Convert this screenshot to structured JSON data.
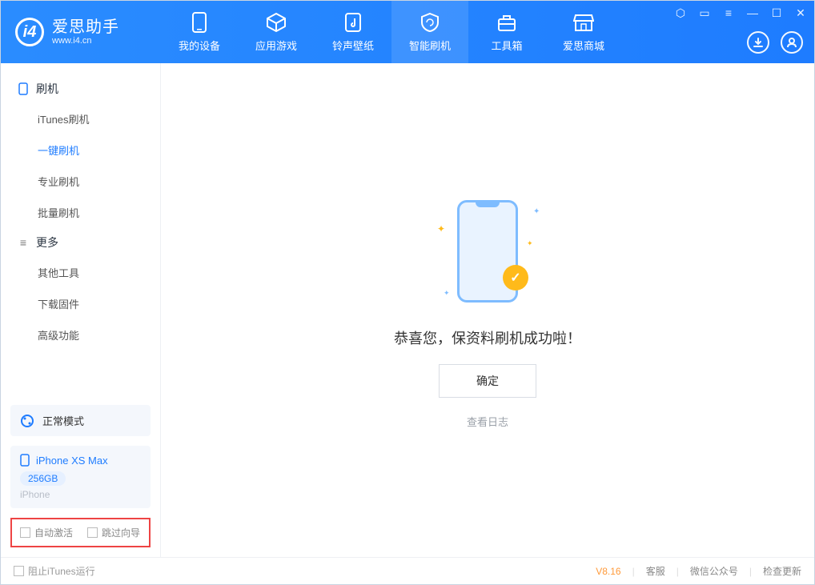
{
  "app": {
    "title": "爱思助手",
    "subtitle": "www.i4.cn"
  },
  "tabs": [
    {
      "id": "device",
      "label": "我的设备"
    },
    {
      "id": "apps",
      "label": "应用游戏"
    },
    {
      "id": "ring",
      "label": "铃声壁纸"
    },
    {
      "id": "flash",
      "label": "智能刷机"
    },
    {
      "id": "tools",
      "label": "工具箱"
    },
    {
      "id": "store",
      "label": "爱思商城"
    }
  ],
  "sidebar": {
    "group1_title": "刷机",
    "items1": [
      {
        "label": "iTunes刷机"
      },
      {
        "label": "一键刷机"
      },
      {
        "label": "专业刷机"
      },
      {
        "label": "批量刷机"
      }
    ],
    "group2_title": "更多",
    "items2": [
      {
        "label": "其他工具"
      },
      {
        "label": "下载固件"
      },
      {
        "label": "高级功能"
      }
    ],
    "mode_label": "正常模式",
    "device": {
      "name": "iPhone XS Max",
      "storage": "256GB",
      "type": "iPhone"
    },
    "chk_auto_activate": "自动激活",
    "chk_skip_guide": "跳过向导"
  },
  "main": {
    "success_message": "恭喜您，保资料刷机成功啦！",
    "ok_button": "确定",
    "view_log": "查看日志"
  },
  "footer": {
    "block_itunes": "阻止iTunes运行",
    "version": "V8.16",
    "support": "客服",
    "wechat": "微信公众号",
    "check_update": "检查更新"
  }
}
